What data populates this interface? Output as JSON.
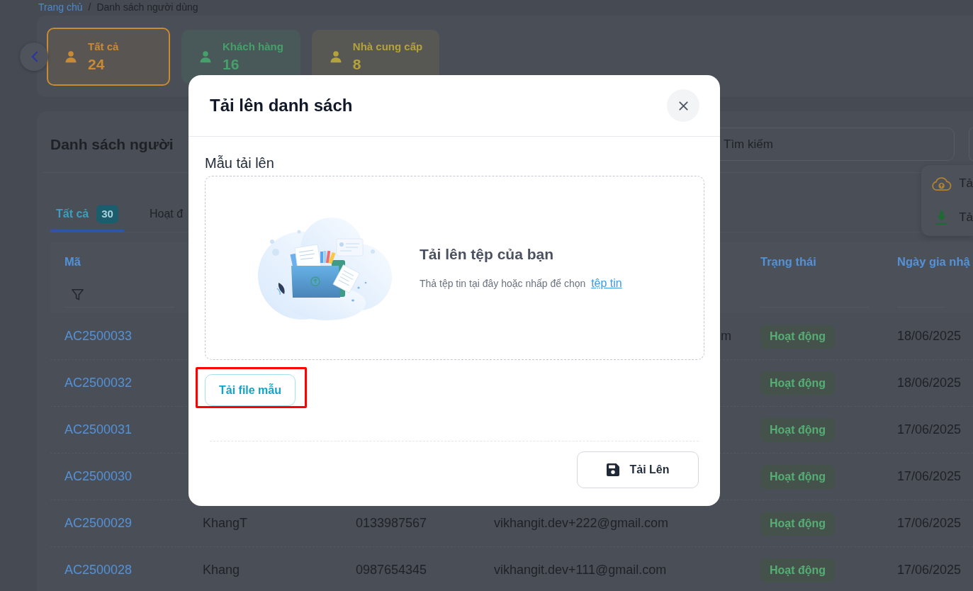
{
  "breadcrumb": {
    "items": [
      {
        "label": "Trang chủ",
        "kind": "link"
      },
      {
        "label": "Danh sách người dùng",
        "kind": "current"
      }
    ],
    "separator": "/"
  },
  "stat_cards": [
    {
      "label": "Tất cả",
      "count": "24",
      "selected": true,
      "color": "#c88a32"
    },
    {
      "label": "Khách hàng",
      "count": "16",
      "selected": false,
      "color": "#45a06a"
    },
    {
      "label": "Nhà cung cấp",
      "count": "8",
      "selected": false,
      "color": "#b4a23a"
    }
  ],
  "list": {
    "title": "Danh sách người",
    "search": {
      "placeholder": "Tìm kiếm"
    },
    "tabs": [
      {
        "label": "Tất cả",
        "count": "30",
        "selected": true
      },
      {
        "label": "Hoạt đ",
        "selected": false
      }
    ],
    "table": {
      "columns": [
        {
          "kind": "code",
          "label": "Mã",
          "filter": true
        },
        {
          "kind": "status",
          "label": "Trạng thái",
          "filter": false
        },
        {
          "kind": "date",
          "label": "Ngày gia nhậ",
          "filter": false
        }
      ],
      "rows": [
        {
          "code": "AC2500033",
          "email_tail": "m",
          "status": {
            "label": "Hoạt động",
            "kind": "active"
          },
          "joined": "18/06/2025"
        },
        {
          "code": "AC2500032",
          "status": {
            "label": "Hoạt động",
            "kind": "active"
          },
          "joined": "18/06/2025"
        },
        {
          "code": "AC2500031",
          "status": {
            "label": "Hoạt động",
            "kind": "active"
          },
          "joined": "17/06/2025"
        },
        {
          "code": "AC2500030",
          "status": {
            "label": "Hoạt động",
            "kind": "active"
          },
          "joined": "17/06/2025"
        },
        {
          "code": "AC2500029",
          "name": "KhangT",
          "phone": "0133987567",
          "email": "vikhangit.dev+222@gmail.com",
          "status": {
            "label": "Hoạt động",
            "kind": "active"
          },
          "joined": "17/06/2025"
        },
        {
          "code": "AC2500028",
          "name": "Khang",
          "phone": "0987654345",
          "email": "vikhangit.dev+111@gmail.com",
          "status": {
            "label": "Hoạt động",
            "kind": "active"
          },
          "joined": "17/06/2025"
        }
      ]
    }
  },
  "upload_menu": {
    "items": [
      {
        "label": "Tả",
        "kind": "upload"
      },
      {
        "label": "Tả",
        "kind": "download"
      }
    ]
  },
  "modal": {
    "title": "Tải lên danh sách",
    "section_label": "Mẫu tải lên",
    "dropzone": {
      "title": "Tải lên tệp của bạn",
      "hint": "Thả tệp tin tại đây hoặc nhấp để chọn",
      "link": "tệp tin"
    },
    "template_button": {
      "label": "Tải file mẫu",
      "highlighted": true
    },
    "submit_button": "Tải Lên"
  }
}
